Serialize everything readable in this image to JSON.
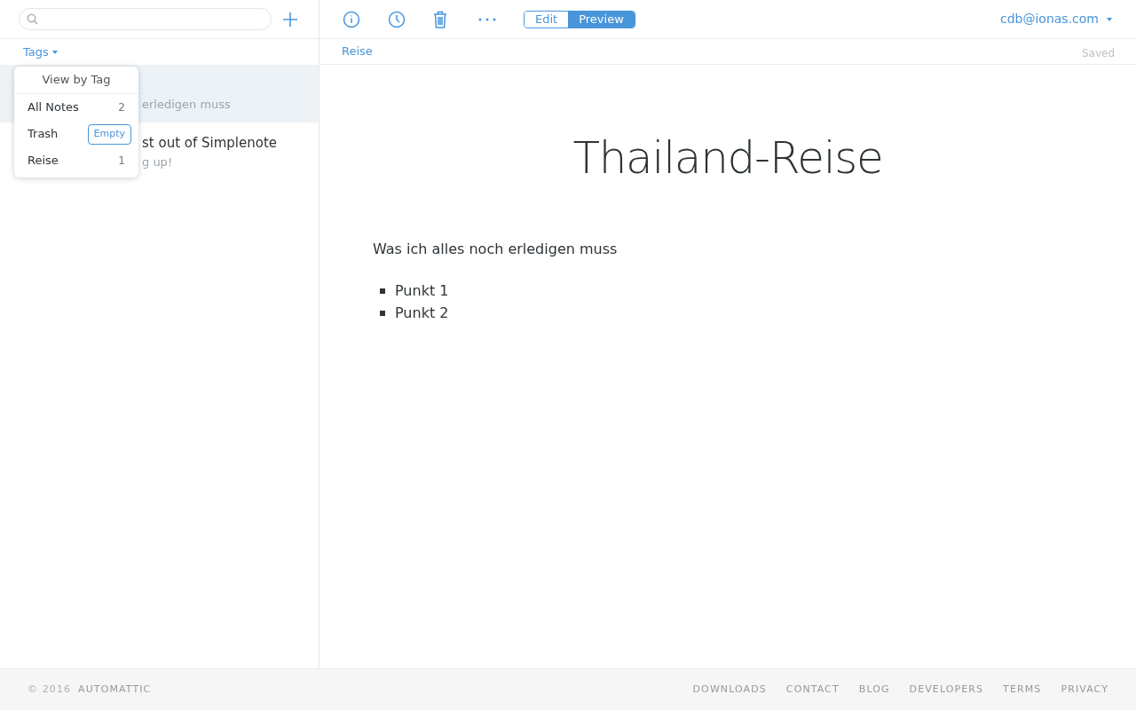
{
  "sidebar": {
    "tags_label": "Tags",
    "notes": [
      {
        "preview": "erledigen muss",
        "selected": true
      },
      {
        "title": "st out of Simplenote",
        "preview": "g up!",
        "selected": false
      }
    ],
    "tag_menu": {
      "title": "View by Tag",
      "items": [
        {
          "kind": "count",
          "label": "All Notes",
          "count": "2"
        },
        {
          "kind": "action",
          "label": "Trash",
          "action": "Empty"
        },
        {
          "kind": "count",
          "label": "Reise",
          "count": "1"
        }
      ]
    }
  },
  "toolbar": {
    "modes": [
      {
        "label": "Edit",
        "selected": false
      },
      {
        "label": "Preview",
        "selected": true
      }
    ],
    "account": "cdb@ionas.com"
  },
  "tagbar": {
    "tag": "Reise",
    "status": "Saved"
  },
  "note": {
    "title": "Thailand-Reise",
    "paragraph": "Was ich alles noch erledigen muss",
    "bullets": [
      "Punkt 1",
      "Punkt 2"
    ]
  },
  "footer": {
    "copyright": "© 2016",
    "brand": "AUTOMATTIC",
    "links": [
      "DOWNLOADS",
      "CONTACT",
      "BLOG",
      "DEVELOPERS",
      "TERMS",
      "PRIVACY"
    ]
  }
}
